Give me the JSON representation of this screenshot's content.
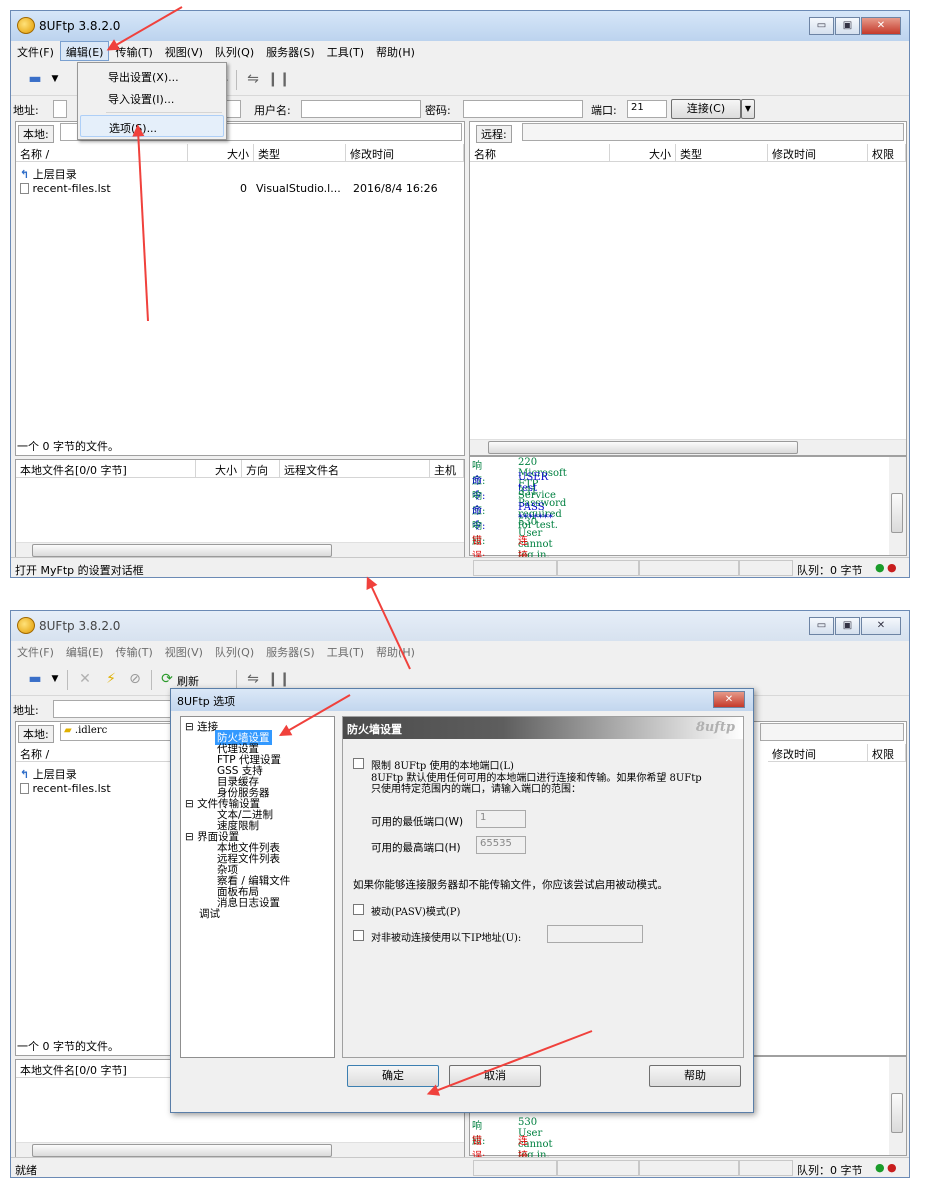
{
  "app_title": "8UFtp 3.8.2.0",
  "window_controls": {
    "minimize": "▭",
    "maximize": "▣",
    "close": "✕"
  },
  "menu": [
    "文件(F)",
    "编辑(E)",
    "传输(T)",
    "视图(V)",
    "队列(Q)",
    "服务器(S)",
    "工具(T)",
    "帮助(H)"
  ],
  "edit_menu": {
    "export": "导出设置(X)...",
    "import": "导入设置(I)...",
    "options": "选项(S)..."
  },
  "toolbar": {
    "refresh_label": "刷新",
    "partial_refresh_label": "新"
  },
  "connect_bar": {
    "address_label": "地址:",
    "user_label": "用户名:",
    "password_label": "密码:",
    "port_label": "端口:",
    "port_value": "21",
    "connect_button": "连接(C)"
  },
  "local_panel": {
    "label": "本地:",
    "path_value": ".idlerc",
    "columns": [
      "名称 /",
      "大小",
      "类型",
      "修改时间"
    ],
    "rows": [
      {
        "name": "上层目录",
        "size": "",
        "type": "",
        "modified": ""
      },
      {
        "name": "recent-files.lst",
        "size": "0",
        "type": "VisualStudio.l...",
        "modified": "2016/8/4 16:26"
      }
    ],
    "file_summary": "一个 0 字节的文件。"
  },
  "remote_panel": {
    "label": "远程:",
    "columns": [
      "名称",
      "大小",
      "类型",
      "修改时间",
      "权限"
    ]
  },
  "queue_panel": {
    "columns": [
      "本地文件名[0/0 字节]",
      "大小",
      "方向",
      "远程文件名",
      "主机"
    ]
  },
  "log": [
    {
      "key": "响应:",
      "value": "220 Microsoft FTP Service",
      "color": "#008040"
    },
    {
      "key": "命令:",
      "value": "USER test",
      "color": "#0000c8"
    },
    {
      "key": "响应:",
      "value": "331 Password required for test.",
      "color": "#008040"
    },
    {
      "key": "命令:",
      "value": "PASS *******",
      "color": "#0000c8"
    },
    {
      "key": "响应:",
      "value": "530 User cannot log in.",
      "color": "#008040"
    },
    {
      "key": "错误:",
      "value": "连接失败",
      "color": "#e00000"
    }
  ],
  "status": {
    "top_message": "打开 MyFtp 的设置对话框",
    "bottom_message": "就绪",
    "queue": "队列：0 字节"
  },
  "options_dialog": {
    "title": "8UFtp 选项",
    "close": "✕",
    "tree": [
      "连接",
      "防火墙设置",
      "代理设置",
      "FTP 代理设置",
      "GSS 支持",
      "目录缓存",
      "身份服务器",
      "文件传输设置",
      "文本/二进制",
      "速度限制",
      "界面设置",
      "本地文件列表",
      "远程文件列表",
      "杂项",
      "察看 / 编辑文件",
      "面板布局",
      "消息日志设置",
      "调试"
    ],
    "section_title": "防火墙设置",
    "brand": "8uftp",
    "limit_ports_label": "限制 8UFtp 使用的本地端口(L)",
    "limit_ports_desc_1": "8UFtp 默认使用任何可用的本地端口进行连接和传输。如果你希望 8UFtp",
    "limit_ports_desc_2": "只使用特定范围内的端口，请输入端口的范围：",
    "min_port_label": "可用的最低端口(W)",
    "min_port_value": "1",
    "max_port_label": "可用的最高端口(H)",
    "max_port_value": "65535",
    "pasv_hint": "如果你能够连接服务器却不能传输文件，你应该尝试启用被动模式。",
    "pasv_label": "被动(PASV)模式(P)",
    "pasv_ip_label": "对非被动连接使用以下IP地址(U):",
    "ok": "确定",
    "cancel": "取消",
    "help": "帮助"
  }
}
